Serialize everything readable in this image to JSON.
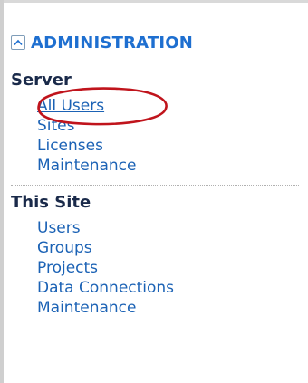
{
  "section": {
    "title": "ADMINISTRATION",
    "collapse_icon": "chevron-up-icon"
  },
  "server": {
    "heading": "Server",
    "links": [
      "All Users",
      "Sites",
      "Licenses",
      "Maintenance"
    ],
    "current": "All Users"
  },
  "this_site": {
    "heading": "This Site",
    "links": [
      "Users",
      "Groups",
      "Projects",
      "Data Connections",
      "Maintenance"
    ]
  },
  "colors": {
    "section_title": "#1e6fd0",
    "heading": "#1a2a4a",
    "link": "#1b62b5",
    "annotation": "#c0141c"
  }
}
